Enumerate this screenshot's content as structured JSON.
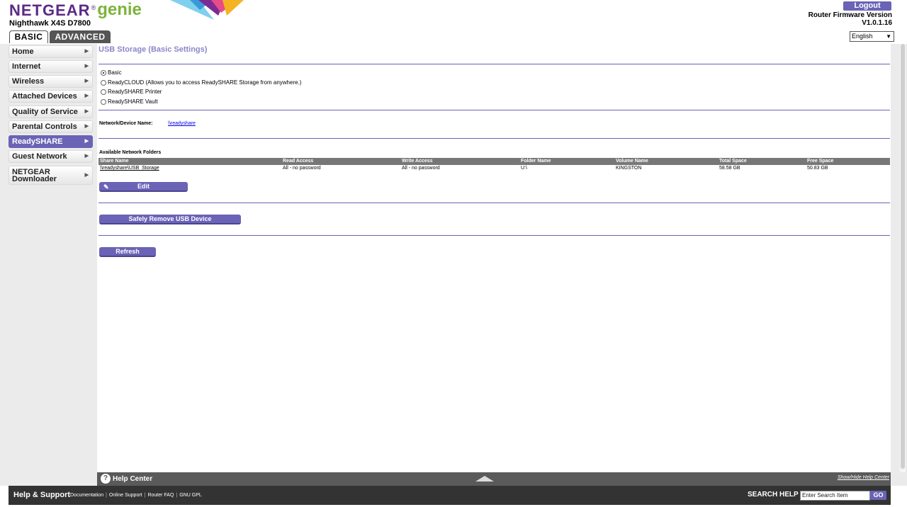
{
  "header": {
    "brand": "NETGEAR",
    "brand_mark": "®",
    "product": "genie",
    "model": "Nighthawk X4S D7800",
    "tabs": [
      {
        "label": "BASIC"
      },
      {
        "label": "ADVANCED"
      }
    ],
    "logout_label": "Logout",
    "firmware_label": "Router Firmware Version",
    "firmware_version": "V1.0.1.16",
    "language": "English"
  },
  "menu": {
    "items": [
      {
        "label": "Home"
      },
      {
        "label": "Internet"
      },
      {
        "label": "Wireless"
      },
      {
        "label": "Attached Devices"
      },
      {
        "label": "Quality of Service"
      },
      {
        "label": "Parental Controls"
      },
      {
        "label": "ReadySHARE"
      },
      {
        "label": "Guest Network"
      },
      {
        "label": "NETGEAR\nDownloader"
      }
    ],
    "active": "ReadySHARE"
  },
  "main": {
    "title": "USB Storage (Basic Settings)",
    "options": [
      {
        "label": "Basic",
        "checked": true
      },
      {
        "label": "ReadyCLOUD (Allows you to access ReadySHARE Storage from anywhere.)",
        "checked": false
      },
      {
        "label": "ReadySHARE Printer",
        "checked": false
      },
      {
        "label": "ReadySHARE Vault",
        "checked": false
      }
    ],
    "device_name_label": "Network/Device Name:",
    "device_name_value": "\\\\readyshare",
    "folders_label": "Available Network Folders",
    "table": {
      "columns": [
        "Share Name",
        "Read Access",
        "Write Access",
        "Folder Name",
        "Volume Name",
        "Total Space",
        "Free Space"
      ],
      "rows": [
        [
          "\\\\readyshare\\USB_Storage",
          "All - no password",
          "All - no password",
          "U:\\",
          "KINGSTON",
          "58.58 GB",
          "50.83 GB"
        ]
      ]
    },
    "edit_label": "Edit",
    "remove_label": "Safely Remove USB Device",
    "refresh_label": "Refresh"
  },
  "help": {
    "title": "Help Center",
    "toggle": "Show/Hide Help Center"
  },
  "footer": {
    "title": "Help & Support",
    "links": [
      "Documentation",
      "Online Support",
      "Router FAQ",
      "GNU GPL"
    ],
    "search_label": "SEARCH HELP",
    "search_placeholder": "Enter Search Item",
    "go_label": "GO"
  },
  "colors": {
    "accent": "#6a63b6",
    "title": "#8b86c9",
    "brand": "#5b2a86",
    "genie": "#7db43a"
  }
}
